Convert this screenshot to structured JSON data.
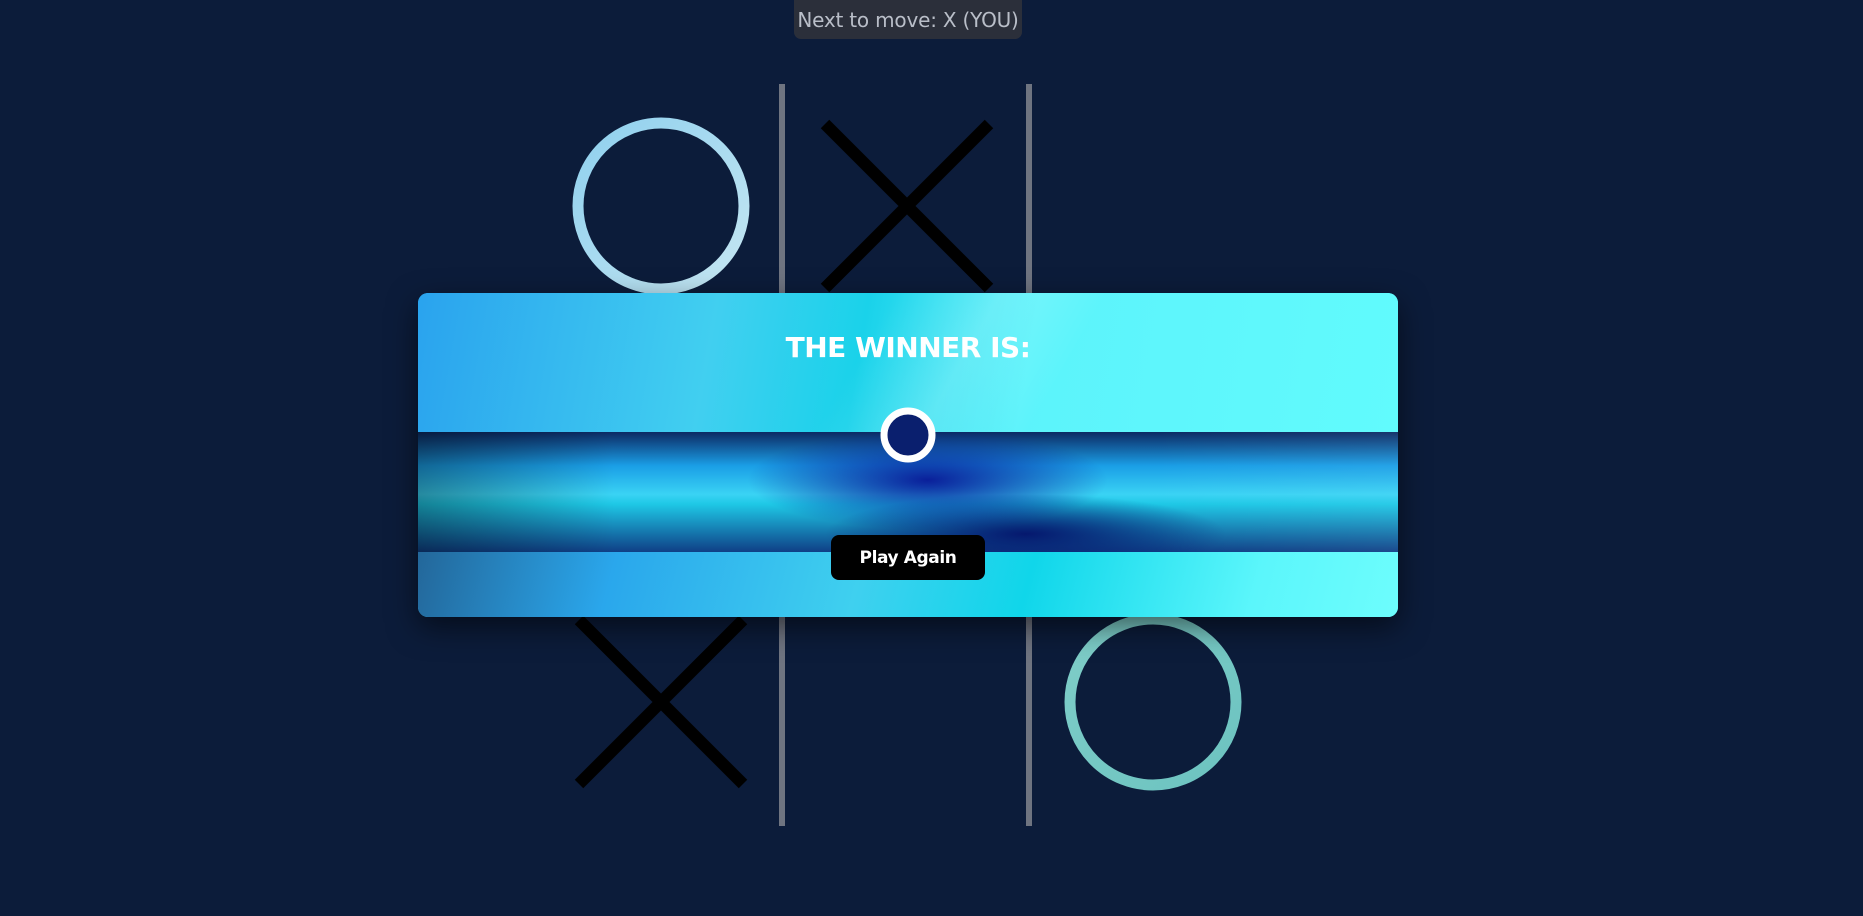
{
  "status": {
    "next_to_move": "Next to move: X (YOU)"
  },
  "board": {
    "cells": [
      "O",
      "X",
      "",
      "",
      "",
      "",
      "X",
      "",
      "O"
    ],
    "o_color_top": "#b4def0",
    "o_color_bottom": "#7fcdc8",
    "x_color": "#000000",
    "grid_color": "#6f7480",
    "background": "#0c1c3a"
  },
  "modal": {
    "title": "THE WINNER IS:",
    "winner": "O",
    "winner_icon": "o-mark-icon",
    "button_label": "Play Again"
  }
}
